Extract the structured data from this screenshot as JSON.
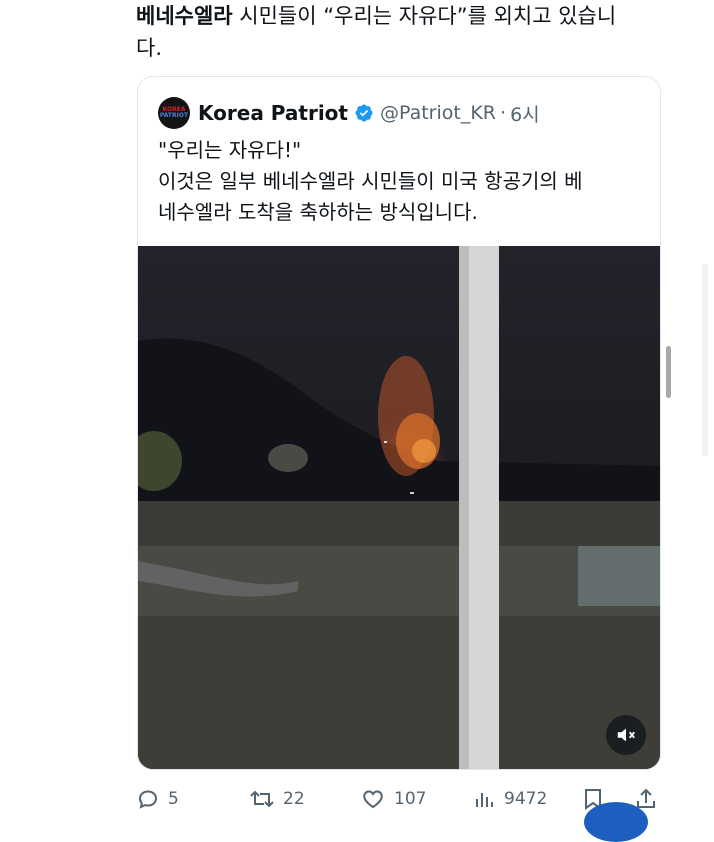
{
  "tweet": {
    "bold_text": "베네수엘라",
    "text_line1": " 시민들이 “우리는 자유다”를 외치고 있습니",
    "text_line2": "다."
  },
  "quote": {
    "avatar": {
      "line1": "KOREA",
      "line2": "PATRIOT",
      "colors": [
        "#d8202a",
        "#4c7fd6"
      ]
    },
    "display_name": "Korea Patriot",
    "verified_icon": "verified-badge-icon",
    "handle": "@Patriot_KR",
    "separator": "·",
    "time": "6시",
    "text_lines": [
      "\"우리는 자유다!\"",
      "이것은 일부 베네수엘라 시민들이 미국 항공기의 베",
      "네수엘라 도착을 축하하는 방식입니다."
    ],
    "video": {
      "mute_icon": "muted-speaker-icon"
    }
  },
  "actions": {
    "reply": {
      "icon": "reply-icon",
      "count": "5"
    },
    "retweet": {
      "icon": "retweet-icon",
      "count": "22"
    },
    "like": {
      "icon": "heart-icon",
      "count": "107"
    },
    "views": {
      "icon": "views-icon",
      "count": "9472"
    },
    "bookmark": {
      "icon": "bookmark-icon"
    },
    "share": {
      "icon": "share-icon"
    }
  },
  "colors": {
    "text_primary": "#0f1419",
    "text_secondary": "#536471",
    "verified_blue": "#1d9bf0",
    "card_border": "#e3e6e9"
  }
}
